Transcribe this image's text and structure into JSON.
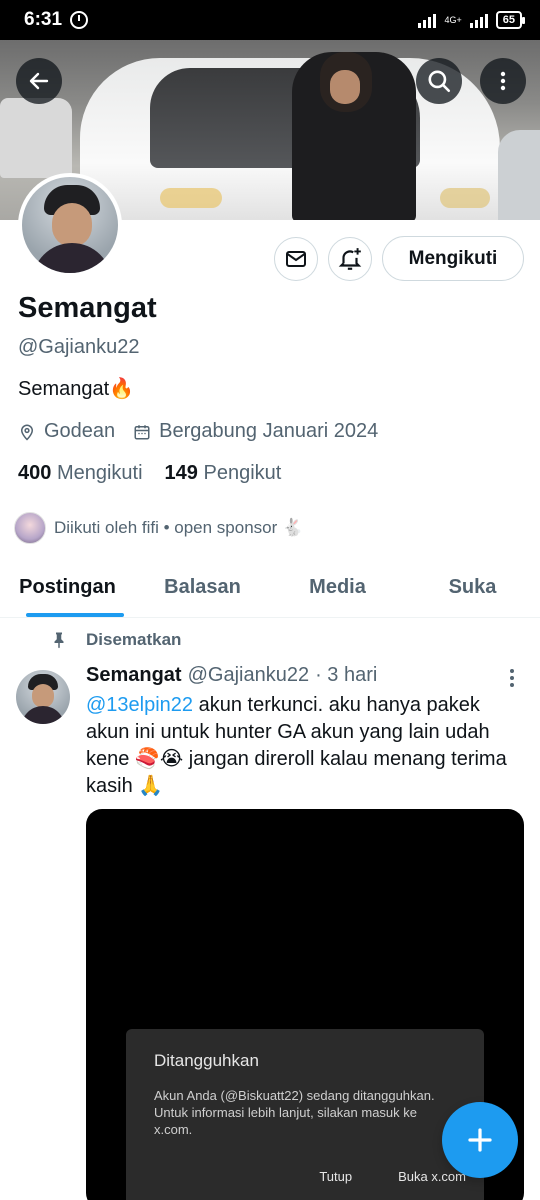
{
  "status_bar": {
    "time": "6:31",
    "network": "4G+",
    "battery": "65"
  },
  "profile": {
    "name": "Semangat",
    "handle": "@Gajianku22",
    "bio": "Semangat🔥",
    "location": "Godean",
    "joined": "Bergabung Januari 2024",
    "following_count": "400",
    "following_label": "Mengikuti",
    "followers_count": "149",
    "followers_label": "Pengikut",
    "followed_by": "Diikuti oleh fifi • open sponsor 🐇",
    "follow_button": "Mengikuti"
  },
  "tabs": [
    "Postingan",
    "Balasan",
    "Media",
    "Suka"
  ],
  "pinned_tweet": {
    "pinned_label": "Disematkan",
    "author": "Semangat",
    "handle": "@Gajianku22",
    "time": "· 3 hari",
    "mention": "@13elpin22",
    "text": " akun terkunci. aku hanya pakek akun ini untuk hunter GA akun yang lain udah kene 🍣😭 jangan direroll kalau menang terima kasih 🙏",
    "media_dialog": {
      "title": "Ditangguhkan",
      "body": "Akun Anda (@Biskuatt22) sedang ditangguhkan. Untuk informasi lebih lanjut, silakan masuk ke x.com.",
      "btn_close": "Tutup",
      "btn_open": "Buka x.com"
    }
  },
  "icons": [
    "back-arrow-icon",
    "search-icon",
    "more-vertical-icon",
    "mail-icon",
    "bell-plus-icon",
    "location-icon",
    "calendar-icon",
    "pin-icon",
    "compose-plus-icon"
  ],
  "colors": {
    "accent": "#1d9bf0",
    "text": "#0f1419",
    "secondary": "#536471"
  }
}
